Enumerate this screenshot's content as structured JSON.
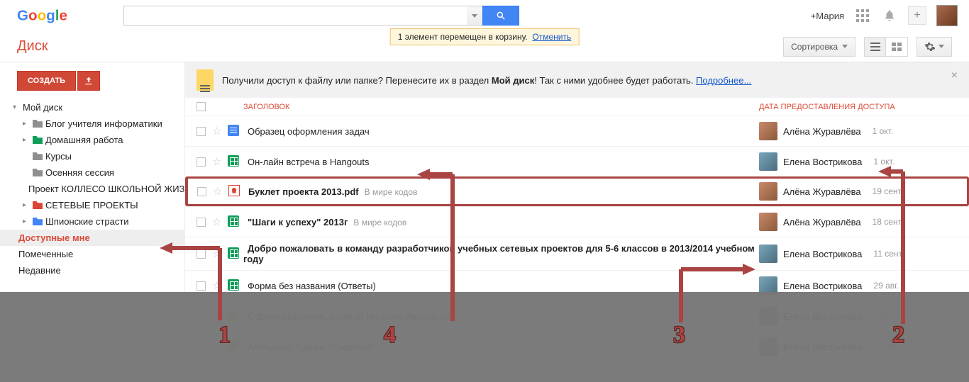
{
  "header": {
    "username": "+Мария",
    "search_placeholder": ""
  },
  "toast": {
    "text": "1 элемент перемещен в корзину.",
    "undo": "Отменить"
  },
  "app": {
    "name": "Диск",
    "sort_label": "Сортировка"
  },
  "sidebar": {
    "create_label": "СОЗДАТЬ",
    "my_drive": "Мой диск",
    "items": [
      "Блог учителя информатики",
      "Домашняя работа",
      "Курсы",
      "Осенняя сессия",
      "Проект КОЛЛЕСО ШКОЛЬНОЙ ЖИЗНИ",
      "СЕТЕВЫЕ ПРОЕКТЫ",
      "Шпионские страсти"
    ],
    "shared": "Доступные мне",
    "starred": "Помеченные",
    "recent": "Недавние"
  },
  "banner": {
    "text_a": "Получили доступ к файлу или папке? Перенесите их в раздел ",
    "bold": "Мой диск",
    "text_b": "! Так с ними удобнее будет работать. ",
    "link": "Подробнее..."
  },
  "columns": {
    "title": "ЗАГОЛОВОК",
    "shared_date": "ДАТА ПРЕДОСТАВЛЕНИЯ ДОСТУПА"
  },
  "files": [
    {
      "title": "Образец оформления задач",
      "icon": "doc",
      "owner": "Алёна Журавлёва",
      "date": "1 окт.",
      "av": "a"
    },
    {
      "title": "Он-лайн встреча в Hangouts",
      "icon": "sheet",
      "owner": "Елена Вострикова",
      "date": "1 окт.",
      "av": "b"
    },
    {
      "title": "Буклет проекта 2013.pdf",
      "icon": "pdf",
      "sub": "В мире кодов",
      "owner": "Алёна Журавлёва",
      "date": "19 сент.",
      "av": "a",
      "selected": true,
      "unread": true
    },
    {
      "title": "\"Шаги к успеху\" 2013г",
      "icon": "sheet",
      "sub": "В мире кодов",
      "owner": "Алёна Журавлёва",
      "date": "18 сент.",
      "av": "a",
      "unread": true
    },
    {
      "title": "Добро пожаловать в команду разработчиков учебных сетевых проектов для 5-6 классов в 2013/2014 учебном году",
      "icon": "sheet",
      "owner": "Елена Вострикова",
      "date": "11 сент.",
      "av": "b",
      "unread": true
    },
    {
      "title": "Форма без названия (Ответы)",
      "icon": "sheet",
      "owner": "Елена Вострикова",
      "date": "29 авг.",
      "av": "b"
    },
    {
      "title": "С Днем рождения, дорогая Наталия Ивановна!!!",
      "icon": "gdoc",
      "owner": "Елена Вострикова",
      "date": "5 авг.",
      "av": "b"
    },
    {
      "title": "Алёнушка, с Днем Рождения!",
      "icon": "gdoc",
      "owner": "Елена Вострикова",
      "date": "19 июля",
      "av": "b"
    }
  ],
  "callouts": {
    "n1": "1",
    "n2": "2",
    "n3": "3",
    "n4": "4"
  }
}
